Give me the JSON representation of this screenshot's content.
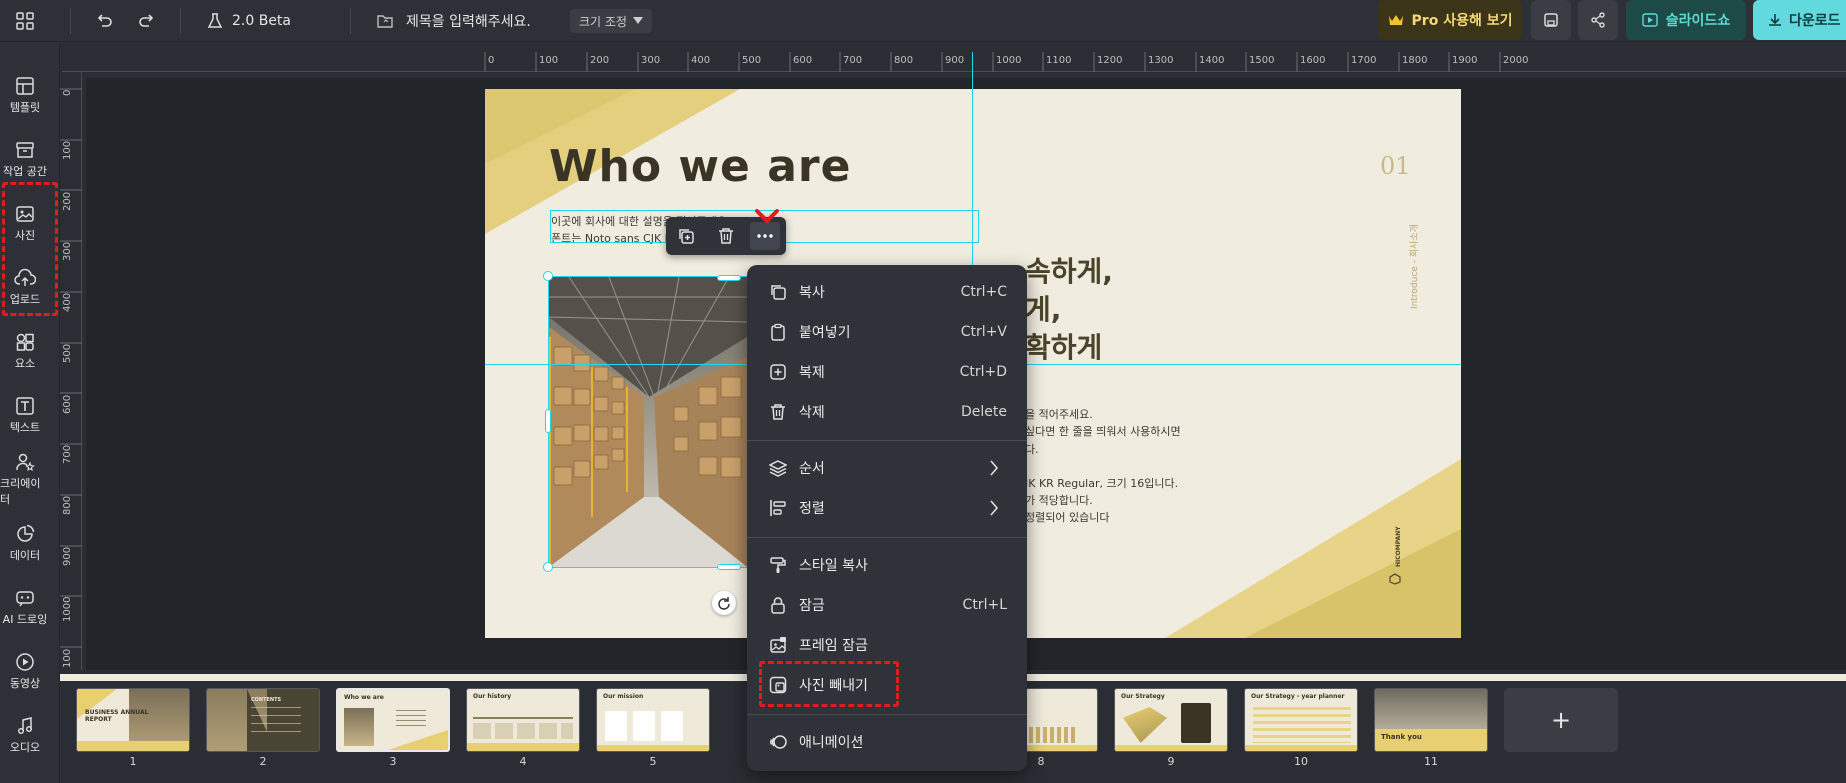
{
  "topbar": {
    "version": "2.0 Beta",
    "title_placeholder": "제목을 입력해주세요.",
    "resize_label": "크기 조정",
    "pro_label": "Pro 사용해 보기",
    "slideshow_label": "슬라이드쇼",
    "download_label": "다운로드"
  },
  "sidebar": {
    "items": [
      {
        "label": "템플릿",
        "icon": "template-icon"
      },
      {
        "label": "작업 공간",
        "icon": "archive-icon"
      },
      {
        "label": "사진",
        "icon": "image-icon"
      },
      {
        "label": "업로드",
        "icon": "cloud-upload-icon"
      },
      {
        "label": "요소",
        "icon": "shapes-icon"
      },
      {
        "label": "텍스트",
        "icon": "text-icon"
      },
      {
        "label": "크리에이터",
        "icon": "creator-icon"
      },
      {
        "label": "데이터",
        "icon": "chart-icon"
      },
      {
        "label": "AI 드로잉",
        "icon": "ai-drawing-icon"
      },
      {
        "label": "동영상",
        "icon": "video-icon"
      },
      {
        "label": "오디오",
        "icon": "music-icon"
      }
    ]
  },
  "ruler": {
    "h_ticks": [
      "0",
      "100",
      "200",
      "300",
      "400",
      "500",
      "600",
      "700",
      "800",
      "900",
      "1000",
      "1100",
      "1200",
      "1300",
      "1400",
      "1500",
      "1600",
      "1700",
      "1800",
      "1900",
      "2000"
    ],
    "v_ticks": [
      "0",
      "100",
      "200",
      "300",
      "400",
      "500",
      "600",
      "700",
      "800",
      "900",
      "1000",
      "100"
    ]
  },
  "slide": {
    "heading": "Who we are",
    "desc_line1": "이곳에 회사에 대한 설명을 적어주세요.",
    "desc_line2": "폰트는 Noto sans CJK KR ",
    "desc_line2_tail": ".",
    "page_num": "01",
    "big_line1": "속하게,",
    "big_line2": "게,",
    "big_line3": "확하게",
    "body_line1": "을 적어주세요.",
    "body_line2": "싶다면 한 줄을 띄워서 사용하시면",
    "body_line3": "다.",
    "body_line4": "JK KR Regular, 크기 16입니다.",
    "body_line5": "가 적당합니다.",
    "body_line6": "정렬되어 있습니다",
    "vertical_text": "Introduce - 회사소개",
    "company_text": "HICOMPANY"
  },
  "context_menu": {
    "items": [
      {
        "label": "복사",
        "shortcut": "Ctrl+C",
        "icon": "copy-icon"
      },
      {
        "label": "붙여넣기",
        "shortcut": "Ctrl+V",
        "icon": "paste-icon"
      },
      {
        "label": "복제",
        "shortcut": "Ctrl+D",
        "icon": "duplicate-icon"
      },
      {
        "label": "삭제",
        "shortcut": "Delete",
        "icon": "trash-icon"
      },
      {
        "label": "순서",
        "shortcut": "",
        "icon": "layers-icon"
      },
      {
        "label": "정렬",
        "shortcut": "",
        "icon": "align-icon"
      },
      {
        "label": "스타일 복사",
        "shortcut": "",
        "icon": "paint-roller-icon"
      },
      {
        "label": "잠금",
        "shortcut": "Ctrl+L",
        "icon": "lock-icon"
      },
      {
        "label": "프레임 잠금",
        "shortcut": "",
        "icon": "frame-lock-icon"
      },
      {
        "label": "사진 빼내기",
        "shortcut": "",
        "icon": "detach-image-icon"
      },
      {
        "label": "애니메이션",
        "shortcut": "",
        "icon": "animation-icon"
      }
    ]
  },
  "filmstrip": {
    "slides": [
      {
        "num": "1",
        "title": "BUSINESS ANNUAL REPORT"
      },
      {
        "num": "2",
        "title": "CONTENTS"
      },
      {
        "num": "3",
        "title": "Who we are"
      },
      {
        "num": "4",
        "title": "Our history"
      },
      {
        "num": "5",
        "title": "Our mission"
      },
      {
        "num": "8",
        "title": ""
      },
      {
        "num": "9",
        "title": "Our Strategy"
      },
      {
        "num": "10",
        "title": "Our Strategy - year planner"
      },
      {
        "num": "11",
        "title": "Thank you"
      }
    ],
    "add_label": "+"
  },
  "colors": {
    "accent_gold": "#e8cf6f",
    "selection_cyan": "#1fd8e8",
    "highlight_red": "#e01c1c",
    "pro_bg": "#3b3418",
    "slideshow_bg": "#1d4946",
    "download_bg": "#62d9dd"
  }
}
